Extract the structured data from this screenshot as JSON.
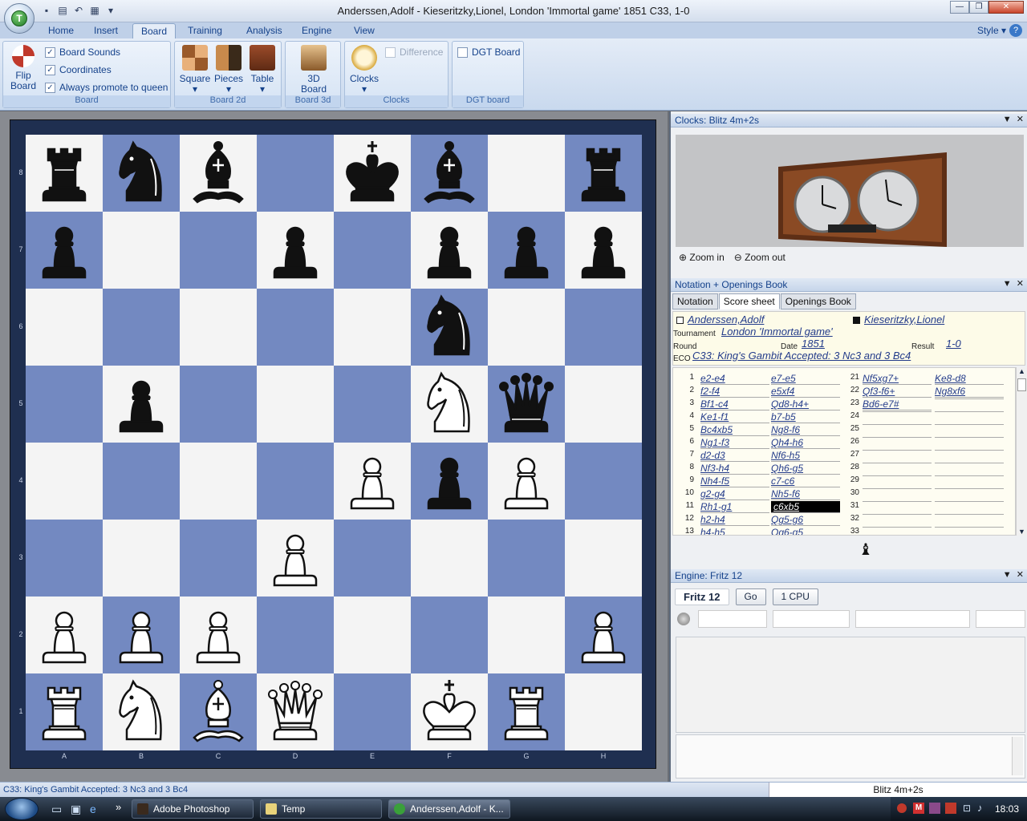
{
  "window": {
    "title": "Anderssen,Adolf - Kieseritzky,Lionel, London 'Immortal game' 1851  C33, 1-0",
    "app_icon": "fritz-logo-icon"
  },
  "ribbon": {
    "tabs": [
      "Home",
      "Insert",
      "Board",
      "Training",
      "Analysis",
      "Engine",
      "View"
    ],
    "active_tab": "Board",
    "style_menu": "Style",
    "groups": {
      "board": {
        "label": "Board",
        "flip_label": "Flip\nBoard",
        "board_sounds": "Board Sounds",
        "coordinates": "Coordinates",
        "always_promote": "Always promote to queen"
      },
      "board2d": {
        "label": "Board 2d",
        "square": "Square",
        "pieces": "Pieces",
        "table": "Table"
      },
      "board3d": {
        "label": "Board 3d",
        "board3d": "3D\nBoard"
      },
      "clocks": {
        "label": "Clocks",
        "clocks": "Clocks",
        "difference": "Difference"
      },
      "dgt": {
        "label": "DGT board",
        "dgt_board": "DGT Board"
      }
    }
  },
  "board": {
    "files": [
      "A",
      "B",
      "C",
      "D",
      "E",
      "F",
      "G",
      "H"
    ],
    "ranks": [
      "8",
      "7",
      "6",
      "5",
      "4",
      "3",
      "2",
      "1"
    ],
    "position": [
      [
        "bR",
        "bN",
        "bB",
        "",
        "bK",
        "bB",
        "",
        "bR"
      ],
      [
        "bP",
        "",
        "",
        "bP",
        "",
        "bP",
        "bP",
        "bP"
      ],
      [
        "",
        "",
        "",
        "",
        "",
        "bN",
        "",
        ""
      ],
      [
        "",
        "bP",
        "",
        "",
        "",
        "wN",
        "bQ",
        ""
      ],
      [
        "",
        "",
        "",
        "",
        "wP",
        "bP",
        "wP",
        ""
      ],
      [
        "",
        "",
        "",
        "wP",
        "",
        "",
        "",
        ""
      ],
      [
        "wP",
        "wP",
        "wP",
        "",
        "",
        "",
        "",
        "wP"
      ],
      [
        "wR",
        "wN",
        "wB",
        "wQ",
        "",
        "wK",
        "wR",
        ""
      ]
    ],
    "light_color": "#f4f4f4",
    "dark_color": "#7389c1"
  },
  "clocks_panel": {
    "title": "Clocks: Blitz 4m+2s",
    "zoom_in": "Zoom in",
    "zoom_out": "Zoom out"
  },
  "notation_panel": {
    "title": "Notation + Openings Book",
    "tabs": [
      "Notation",
      "Score sheet",
      "Openings Book"
    ],
    "active_tab": "Score sheet",
    "white": "Anderssen,Adolf",
    "black": "Kieseritzky,Lionel",
    "tournament_label": "Tournament",
    "tournament": "London 'Immortal game'",
    "round_label": "Round",
    "date_label": "Date",
    "date": "1851",
    "result_label": "Result",
    "result": "1-0",
    "eco_label": "ECO",
    "eco": "C33: King's Gambit Accepted: 3 Nc3 and 3 Bc4",
    "moves_left": [
      [
        "1",
        "e2-e4",
        "e7-e5"
      ],
      [
        "2",
        "f2-f4",
        "e5xf4"
      ],
      [
        "3",
        "Bf1-c4",
        "Qd8-h4+"
      ],
      [
        "4",
        "Ke1-f1",
        "b7-b5"
      ],
      [
        "5",
        "Bc4xb5",
        "Ng8-f6"
      ],
      [
        "6",
        "Ng1-f3",
        "Qh4-h6"
      ],
      [
        "7",
        "d2-d3",
        "Nf6-h5"
      ],
      [
        "8",
        "Nf3-h4",
        "Qh6-g5"
      ],
      [
        "9",
        "Nh4-f5",
        "c7-c6"
      ],
      [
        "10",
        "g2-g4",
        "Nh5-f6"
      ],
      [
        "11",
        "Rh1-g1",
        "c6xb5"
      ],
      [
        "12",
        "h2-h4",
        "Qg5-g6"
      ],
      [
        "13",
        "h4-h5",
        "Qg6-g5"
      ]
    ],
    "moves_right": [
      [
        "21",
        "Nf5xg7+",
        "Ke8-d8"
      ],
      [
        "22",
        "Qf3-f6+",
        "Ng8xf6"
      ],
      [
        "23",
        "Bd6-e7#",
        ""
      ],
      [
        "24",
        "",
        ""
      ],
      [
        "25",
        "",
        ""
      ],
      [
        "26",
        "",
        ""
      ],
      [
        "27",
        "",
        ""
      ],
      [
        "28",
        "",
        ""
      ],
      [
        "29",
        "",
        ""
      ],
      [
        "30",
        "",
        ""
      ],
      [
        "31",
        "",
        ""
      ],
      [
        "32",
        "",
        ""
      ],
      [
        "33",
        "",
        ""
      ]
    ],
    "selected_move": "c6xb5"
  },
  "engine_panel": {
    "title": "Engine: Fritz 12",
    "engine_name": "Fritz 12",
    "go": "Go",
    "cpu": "1 CPU"
  },
  "status": {
    "left": "C33: King's Gambit Accepted: 3 Nc3 and 3 Bc4",
    "right": "Blitz 4m+2s"
  },
  "taskbar": {
    "tasks": [
      "Adobe Photoshop",
      "Temp",
      "Anderssen,Adolf - K..."
    ],
    "active_task": 2,
    "time": "18:03"
  }
}
